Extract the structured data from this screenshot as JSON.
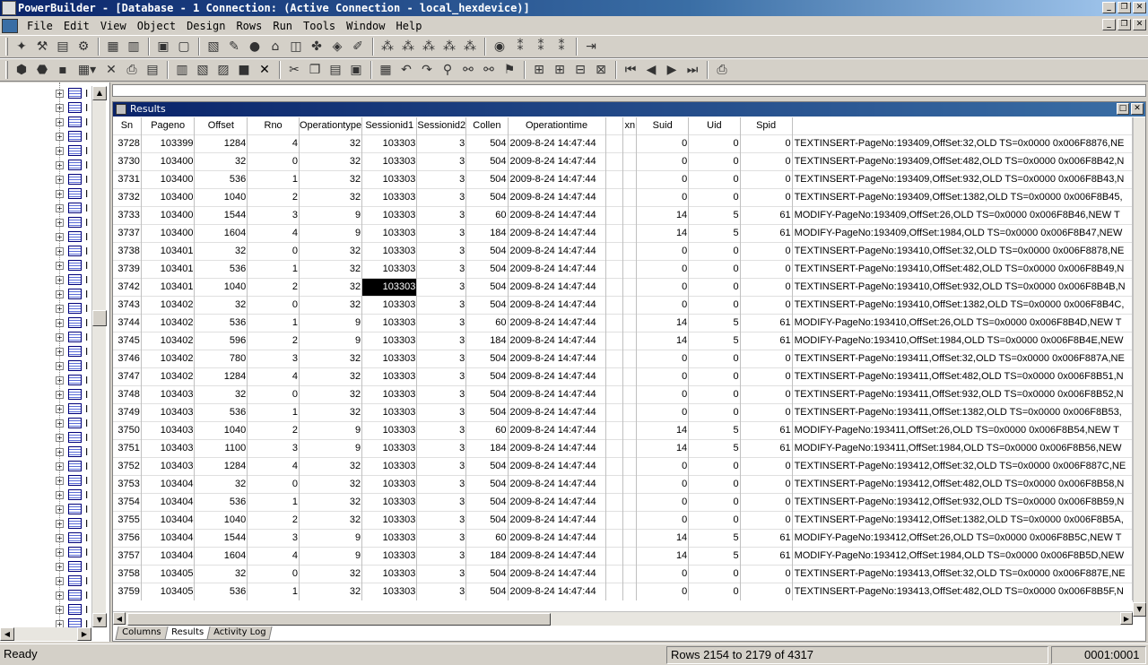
{
  "window": {
    "title": "PowerBuilder - [Database - 1 Connection: (Active Connection - local_hexdevice)]"
  },
  "menu": [
    "File",
    "Edit",
    "View",
    "Object",
    "Design",
    "Rows",
    "Run",
    "Tools",
    "Window",
    "Help"
  ],
  "tree": {
    "label": "I",
    "row_count": 38
  },
  "results": {
    "title": "Results",
    "columns": [
      "Sn",
      "Pageno",
      "Offset",
      "Rno",
      "Operationtype",
      "Sessionid1",
      "Sessionid2",
      "Collen",
      "Operationtime",
      "",
      "xn",
      "Suid",
      "Uid",
      "Spid",
      ""
    ],
    "rows": [
      [
        "3728",
        "103399",
        "1284",
        "4",
        "32",
        "103303",
        "3",
        "504",
        "2009-8-24 14:47:44",
        "",
        "",
        "0",
        "0",
        "0",
        "TEXTINSERT-PageNo:193409,OffSet:32,OLD TS=0x0000 0x006F8876,NE"
      ],
      [
        "3730",
        "103400",
        "32",
        "0",
        "32",
        "103303",
        "3",
        "504",
        "2009-8-24 14:47:44",
        "",
        "",
        "0",
        "0",
        "0",
        "TEXTINSERT-PageNo:193409,OffSet:482,OLD TS=0x0000 0x006F8B42,N"
      ],
      [
        "3731",
        "103400",
        "536",
        "1",
        "32",
        "103303",
        "3",
        "504",
        "2009-8-24 14:47:44",
        "",
        "",
        "0",
        "0",
        "0",
        "TEXTINSERT-PageNo:193409,OffSet:932,OLD TS=0x0000 0x006F8B43,N"
      ],
      [
        "3732",
        "103400",
        "1040",
        "2",
        "32",
        "103303",
        "3",
        "504",
        "2009-8-24 14:47:44",
        "",
        "",
        "0",
        "0",
        "0",
        "TEXTINSERT-PageNo:193409,OffSet:1382,OLD TS=0x0000 0x006F8B45,"
      ],
      [
        "3733",
        "103400",
        "1544",
        "3",
        "9",
        "103303",
        "3",
        "60",
        "2009-8-24 14:47:44",
        "",
        "",
        "14",
        "5",
        "61",
        "MODIFY-PageNo:193409,OffSet:26,OLD TS=0x0000 0x006F8B46,NEW T"
      ],
      [
        "3737",
        "103400",
        "1604",
        "4",
        "9",
        "103303",
        "3",
        "184",
        "2009-8-24 14:47:44",
        "",
        "",
        "14",
        "5",
        "61",
        "MODIFY-PageNo:193409,OffSet:1984,OLD TS=0x0000 0x006F8B47,NEW"
      ],
      [
        "3738",
        "103401",
        "32",
        "0",
        "32",
        "103303",
        "3",
        "504",
        "2009-8-24 14:47:44",
        "",
        "",
        "0",
        "0",
        "0",
        "TEXTINSERT-PageNo:193410,OffSet:32,OLD TS=0x0000 0x006F8878,NE"
      ],
      [
        "3739",
        "103401",
        "536",
        "1",
        "32",
        "103303",
        "3",
        "504",
        "2009-8-24 14:47:44",
        "",
        "",
        "0",
        "0",
        "0",
        "TEXTINSERT-PageNo:193410,OffSet:482,OLD TS=0x0000 0x006F8B49,N"
      ],
      [
        "3742",
        "103401",
        "1040",
        "2",
        "32",
        "103303",
        "3",
        "504",
        "2009-8-24 14:47:44",
        "",
        "",
        "0",
        "0",
        "0",
        "TEXTINSERT-PageNo:193410,OffSet:932,OLD TS=0x0000 0x006F8B4B,N"
      ],
      [
        "3743",
        "103402",
        "32",
        "0",
        "32",
        "103303",
        "3",
        "504",
        "2009-8-24 14:47:44",
        "",
        "",
        "0",
        "0",
        "0",
        "TEXTINSERT-PageNo:193410,OffSet:1382,OLD TS=0x0000 0x006F8B4C,"
      ],
      [
        "3744",
        "103402",
        "536",
        "1",
        "9",
        "103303",
        "3",
        "60",
        "2009-8-24 14:47:44",
        "",
        "",
        "14",
        "5",
        "61",
        "MODIFY-PageNo:193410,OffSet:26,OLD TS=0x0000 0x006F8B4D,NEW T"
      ],
      [
        "3745",
        "103402",
        "596",
        "2",
        "9",
        "103303",
        "3",
        "184",
        "2009-8-24 14:47:44",
        "",
        "",
        "14",
        "5",
        "61",
        "MODIFY-PageNo:193410,OffSet:1984,OLD TS=0x0000 0x006F8B4E,NEW"
      ],
      [
        "3746",
        "103402",
        "780",
        "3",
        "32",
        "103303",
        "3",
        "504",
        "2009-8-24 14:47:44",
        "",
        "",
        "0",
        "0",
        "0",
        "TEXTINSERT-PageNo:193411,OffSet:32,OLD TS=0x0000 0x006F887A,NE"
      ],
      [
        "3747",
        "103402",
        "1284",
        "4",
        "32",
        "103303",
        "3",
        "504",
        "2009-8-24 14:47:44",
        "",
        "",
        "0",
        "0",
        "0",
        "TEXTINSERT-PageNo:193411,OffSet:482,OLD TS=0x0000 0x006F8B51,N"
      ],
      [
        "3748",
        "103403",
        "32",
        "0",
        "32",
        "103303",
        "3",
        "504",
        "2009-8-24 14:47:44",
        "",
        "",
        "0",
        "0",
        "0",
        "TEXTINSERT-PageNo:193411,OffSet:932,OLD TS=0x0000 0x006F8B52,N"
      ],
      [
        "3749",
        "103403",
        "536",
        "1",
        "32",
        "103303",
        "3",
        "504",
        "2009-8-24 14:47:44",
        "",
        "",
        "0",
        "0",
        "0",
        "TEXTINSERT-PageNo:193411,OffSet:1382,OLD TS=0x0000 0x006F8B53,"
      ],
      [
        "3750",
        "103403",
        "1040",
        "2",
        "9",
        "103303",
        "3",
        "60",
        "2009-8-24 14:47:44",
        "",
        "",
        "14",
        "5",
        "61",
        "MODIFY-PageNo:193411,OffSet:26,OLD TS=0x0000 0x006F8B54,NEW T"
      ],
      [
        "3751",
        "103403",
        "1100",
        "3",
        "9",
        "103303",
        "3",
        "184",
        "2009-8-24 14:47:44",
        "",
        "",
        "14",
        "5",
        "61",
        "MODIFY-PageNo:193411,OffSet:1984,OLD TS=0x0000 0x006F8B56,NEW"
      ],
      [
        "3752",
        "103403",
        "1284",
        "4",
        "32",
        "103303",
        "3",
        "504",
        "2009-8-24 14:47:44",
        "",
        "",
        "0",
        "0",
        "0",
        "TEXTINSERT-PageNo:193412,OffSet:32,OLD TS=0x0000 0x006F887C,NE"
      ],
      [
        "3753",
        "103404",
        "32",
        "0",
        "32",
        "103303",
        "3",
        "504",
        "2009-8-24 14:47:44",
        "",
        "",
        "0",
        "0",
        "0",
        "TEXTINSERT-PageNo:193412,OffSet:482,OLD TS=0x0000 0x006F8B58,N"
      ],
      [
        "3754",
        "103404",
        "536",
        "1",
        "32",
        "103303",
        "3",
        "504",
        "2009-8-24 14:47:44",
        "",
        "",
        "0",
        "0",
        "0",
        "TEXTINSERT-PageNo:193412,OffSet:932,OLD TS=0x0000 0x006F8B59,N"
      ],
      [
        "3755",
        "103404",
        "1040",
        "2",
        "32",
        "103303",
        "3",
        "504",
        "2009-8-24 14:47:44",
        "",
        "",
        "0",
        "0",
        "0",
        "TEXTINSERT-PageNo:193412,OffSet:1382,OLD TS=0x0000 0x006F8B5A,"
      ],
      [
        "3756",
        "103404",
        "1544",
        "3",
        "9",
        "103303",
        "3",
        "60",
        "2009-8-24 14:47:44",
        "",
        "",
        "14",
        "5",
        "61",
        "MODIFY-PageNo:193412,OffSet:26,OLD TS=0x0000 0x006F8B5C,NEW T"
      ],
      [
        "3757",
        "103404",
        "1604",
        "4",
        "9",
        "103303",
        "3",
        "184",
        "2009-8-24 14:47:44",
        "",
        "",
        "14",
        "5",
        "61",
        "MODIFY-PageNo:193412,OffSet:1984,OLD TS=0x0000 0x006F8B5D,NEW"
      ],
      [
        "3758",
        "103405",
        "32",
        "0",
        "32",
        "103303",
        "3",
        "504",
        "2009-8-24 14:47:44",
        "",
        "",
        "0",
        "0",
        "0",
        "TEXTINSERT-PageNo:193413,OffSet:32,OLD TS=0x0000 0x006F887E,NE"
      ],
      [
        "3759",
        "103405",
        "536",
        "1",
        "32",
        "103303",
        "3",
        "504",
        "2009-8-24 14:47:44",
        "",
        "",
        "0",
        "0",
        "0",
        "TEXTINSERT-PageNo:193413,OffSet:482,OLD TS=0x0000 0x006F8B5F,N"
      ]
    ],
    "tabs": [
      "Columns",
      "Results",
      "Activity Log"
    ]
  },
  "status": {
    "message": "Ready",
    "rows": "Rows 2154 to 2179 of 4317",
    "position": "0001:0001"
  },
  "colors": {
    "titlebar": "#0a246a",
    "selection": "#000000",
    "face": "#d4d0c8"
  }
}
